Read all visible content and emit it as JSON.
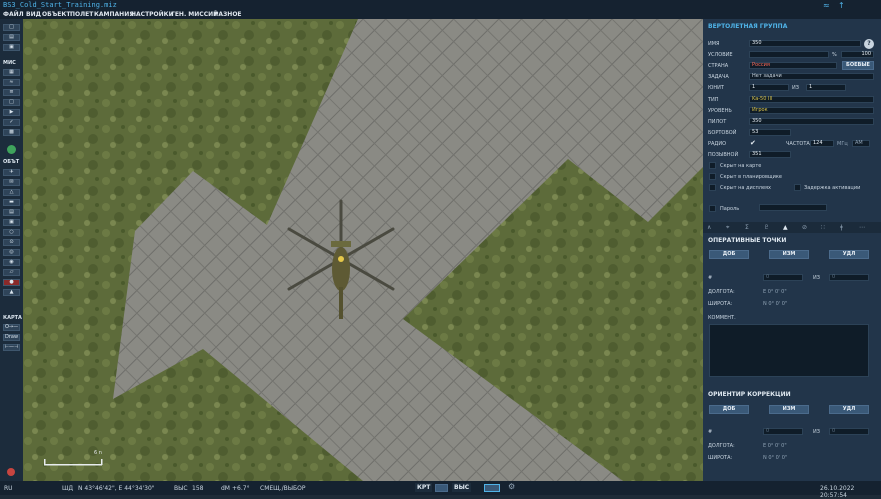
{
  "window": {
    "title": "BS3_Cold_Start_Training.miz"
  },
  "menu": [
    "ФАЙЛ",
    "ВИД",
    "ОБЪЕКТ",
    "ПОЛЕТ",
    "КАМПАНИЯ",
    "НАСТРОЙКИ",
    "ГЕН. МИССИЙ",
    "РАЗНОЕ"
  ],
  "left_toolbar": {
    "mis_label": "МИС",
    "obj_label": "ОБЪТ",
    "map_label": "КАРТА",
    "map_buttons": [
      "O→—",
      "Draw",
      "⊢—⊣"
    ]
  },
  "map": {
    "scale_label": "6 n"
  },
  "panel": {
    "title": "ВЕРТОЛЕТНАЯ ГРУППА",
    "name_label": "ИМЯ",
    "name_value": "350",
    "help_label": "?",
    "condition_label": "УСЛОВИЕ",
    "condition_pct": "%",
    "condition_value": "100",
    "country_label": "СТРАНА",
    "country_value": "Россия",
    "combat_button": "БОЕВЫЕ",
    "task_label": "ЗАДАЧА",
    "task_value": "Нет задачи",
    "unit_label": "ЮНИТ",
    "unit_value": "1",
    "unit_of": "ИЗ",
    "unit_total": "1",
    "type_label": "ТИП",
    "type_value": "Ka-50 III",
    "level_label": "УРОВЕНЬ",
    "level_value": "Игрок",
    "pilot_label": "ПИЛОТ",
    "pilot_value": "350",
    "tail_label": "БОРТОВОЙ",
    "tail_value": "53",
    "radio_label": "РАДИО",
    "radio_check": "✔",
    "freq_label": "ЧАСТОТА",
    "freq_value": "124",
    "freq_unit": "МГц",
    "am_label": "AM",
    "callsign_label": "ПОЗЫВНОЙ",
    "callsign_value": "351",
    "hidden_map": "Скрыт на карте",
    "hidden_planner": "Скрыт в планировщике",
    "hidden_display": "Скрыт на дисплеях",
    "delay_activation": "Задержка активации",
    "password_label": "Пароль",
    "tab_icons": [
      "∧",
      "⌖",
      "Σ",
      "♇",
      "▲",
      "⊘",
      "∷",
      "ǂ",
      "⋯"
    ],
    "wp_title": "ОПЕРАТИВНЫЕ ТОЧКИ",
    "add": "ДОБ",
    "edit": "ИЗМ",
    "del": "УДЛ",
    "hash_label": "#",
    "of_label": "ИЗ",
    "field_placeholder": "0",
    "lon_label": "ДОЛГОТА:",
    "lon_value": "E  0° 0' 0\"",
    "lat_label": "ШИРОТА:",
    "lat_value": "N  0° 0' 0\"",
    "comment_label": "КОММЕНТ.",
    "corr_title": "ОРИЕНТИР КОРРЕКЦИИ"
  },
  "status": {
    "lang": "RU",
    "coords_label": "ШД",
    "coords": "N 43°46'42\", E 44°34'30\"",
    "alt_label": "ВЫС",
    "alt_value": "158",
    "dm_label": "dM",
    "dm_value": "+6.7°",
    "mode": "СМЕЩ./ВЫБОР",
    "krt": "КРТ",
    "vys": "ВЫС",
    "datetime": "26.10.2022 20:57:54"
  },
  "colors": {
    "accent": "#4fb3e8",
    "panel": "#22354a",
    "field": "#0f1c28",
    "button": "#3a5978",
    "yellow_text": "#d8c24a",
    "red_text": "#ff6b5a"
  }
}
